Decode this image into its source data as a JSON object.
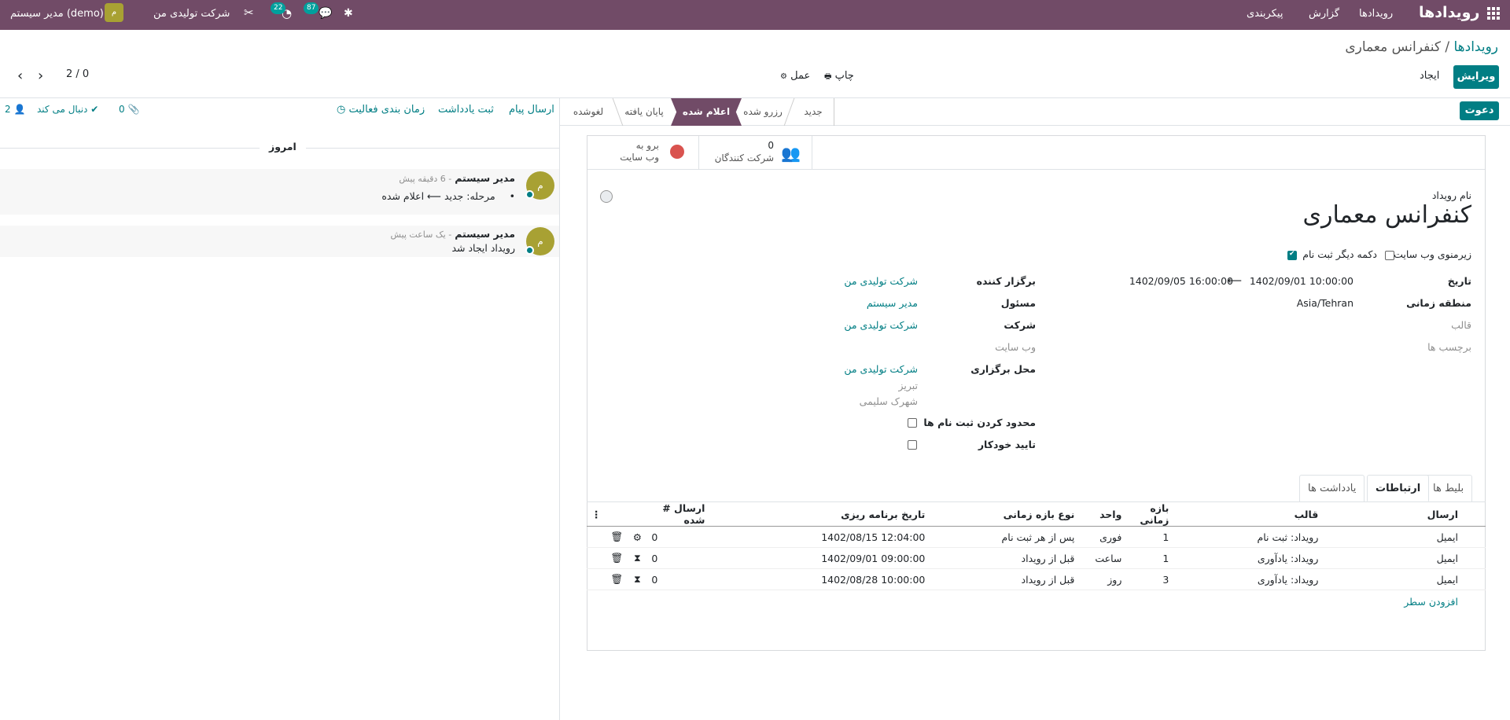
{
  "navbar": {
    "app_name": "رویدادها",
    "menu": [
      "رویدادها",
      "گزارش",
      "پیکربندی"
    ],
    "company": "شرکت تولیدی من",
    "user": "مدیر سیستم (demo)",
    "user_initial": "م",
    "chat_count": "87",
    "activity_count": "22"
  },
  "breadcrumb": {
    "parent": "رویدادها",
    "separator": "/",
    "current": "کنفرانس معماری"
  },
  "actions": {
    "edit": "ویرایش",
    "create": "ایجاد",
    "print": "چاپ",
    "action": "عمل"
  },
  "pager": {
    "value": "2 / 0"
  },
  "statusbar": {
    "invite_button": "دعوت",
    "stages": [
      "جدید",
      "رزرو شده",
      "اعلام شده",
      "پایان یافته",
      "لغوشده"
    ],
    "active_stage": "اعلام شده"
  },
  "smart_buttons": {
    "attendees_count": "0",
    "attendees_label": "شرکت کنندگان",
    "website_line1": "برو به",
    "website_line2": "وب سایت"
  },
  "form": {
    "name_label": "نام رویداد",
    "name": "کنفرانس معماری",
    "website_submenu_label": "زیرمنوی وب سایت",
    "register_button_label": "دکمه دیگر ثبت نام",
    "date_label": "تاریخ",
    "date_start": "1402/09/01 10:00:00",
    "date_arrow": "⟵",
    "date_end": "1402/09/05 16:00:00",
    "tz_label": "منطقه زمانی",
    "tz": "Asia/Tehran",
    "template_label": "قالب",
    "tags_label": "برچسب ها",
    "organizer_label": "برگزار کننده",
    "organizer": "شرکت تولیدی من",
    "responsible_label": "مسئول",
    "responsible": "مدیر سیستم",
    "company_label": "شرکت",
    "company": "شرکت تولیدی من",
    "website_label": "وب سایت",
    "venue_label": "محل برگزاری",
    "venue_name": "شرکت تولیدی من",
    "venue_city": "تبریز",
    "venue_district": "شهرک سلیمی",
    "limit_label": "محدود کردن ثبت نام ها",
    "auto_confirm_label": "تایید خودکار"
  },
  "tabs": [
    "بلیط ها",
    "ارتباطات",
    "یادداشت ها"
  ],
  "active_tab": "ارتباطات",
  "mail_table": {
    "headers": [
      "ارسال",
      "قالب",
      "بازه زمانی",
      "واحد",
      "نوع بازه زمانی",
      "تاریخ برنامه ریزی",
      "# ارسال شده"
    ],
    "rows": [
      {
        "send": "ایمیل",
        "template": "رویداد: ثبت نام",
        "interval": "1",
        "unit": "فوری",
        "type": "پس از هر ثبت نام",
        "date": "1402/08/15 12:04:00",
        "sent": "0",
        "status_icon": "gears-icon"
      },
      {
        "send": "ایمیل",
        "template": "رویداد: یادآوری",
        "interval": "1",
        "unit": "ساعت",
        "type": "قبل از رویداد",
        "date": "1402/09/01 09:00:00",
        "sent": "0",
        "status_icon": "hourglass-icon"
      },
      {
        "send": "ایمیل",
        "template": "رویداد: یادآوری",
        "interval": "3",
        "unit": "روز",
        "type": "قبل از رویداد",
        "date": "1402/08/28 10:00:00",
        "sent": "0",
        "status_icon": "hourglass-icon"
      }
    ],
    "add_line": "افزودن سطر"
  },
  "chatter": {
    "send_message": "ارسال پیام",
    "log_note": "ثبت یادداشت",
    "schedule_activity": "زمان بندی فعالیت",
    "attachments_count": "0",
    "following": "دنبال می کند",
    "followers_count": "2",
    "today": "امروز",
    "messages": [
      {
        "author": "مدیر سیستم",
        "time": "- 6 دقیقه پیش",
        "tracking_label": "مرحله:",
        "old": "جدید",
        "arrow": "⟵",
        "new": "اعلام شده"
      },
      {
        "author": "مدیر سیستم",
        "time": "- یک ساعت پیش",
        "body": "رویداد ایجاد شد"
      }
    ]
  },
  "colors": {
    "brand": "#714b67",
    "accent": "#017e84"
  }
}
